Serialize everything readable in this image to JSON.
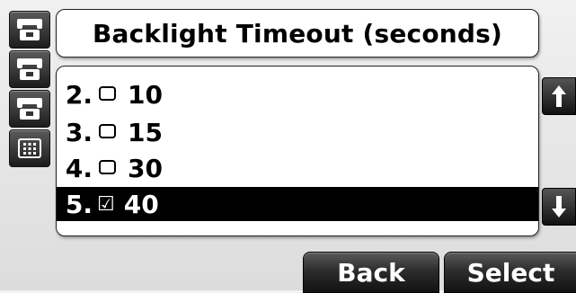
{
  "line_keys": [
    {
      "icon": "handset-icon"
    },
    {
      "icon": "handset-icon"
    },
    {
      "icon": "handset-icon"
    },
    {
      "icon": "keypad-icon"
    }
  ],
  "title": "Backlight Timeout (seconds)",
  "options": [
    {
      "number": "2.",
      "value": "10",
      "checked": false,
      "selected": false
    },
    {
      "number": "3.",
      "value": "15",
      "checked": false,
      "selected": false
    },
    {
      "number": "4.",
      "value": "30",
      "checked": false,
      "selected": false
    },
    {
      "number": "5.",
      "value": "40",
      "checked": true,
      "selected": true
    }
  ],
  "scroll": {
    "up_icon": "arrow-up-icon",
    "down_icon": "arrow-down-icon"
  },
  "softkeys": {
    "back_label": "Back",
    "select_label": "Select"
  }
}
